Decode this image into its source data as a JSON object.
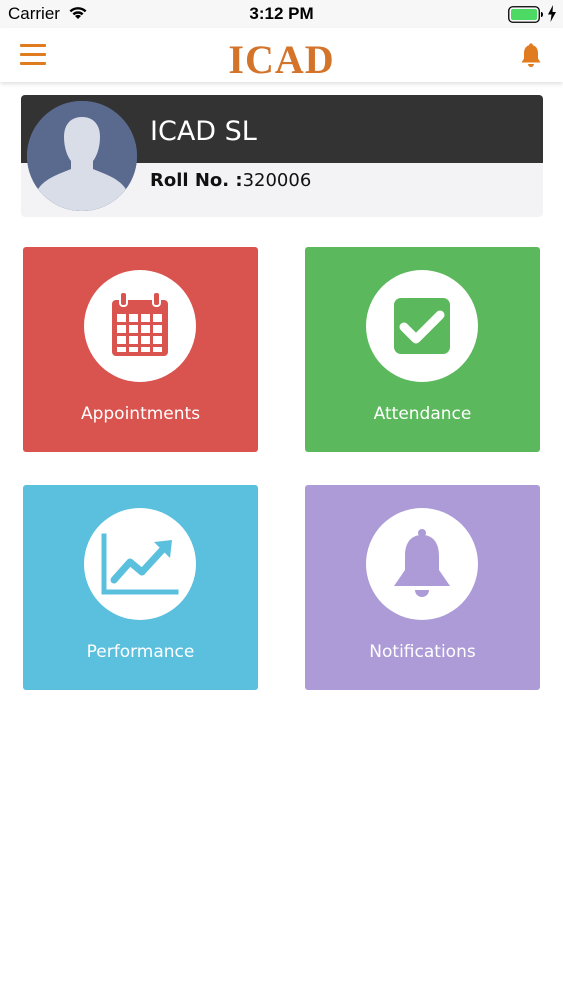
{
  "status_bar": {
    "carrier": "Carrier",
    "time": "3:12 PM",
    "battery_color": "#4cd964"
  },
  "navbar": {
    "title": "ICAD",
    "title_color": "#d4742a",
    "accent": "#e07b1f",
    "menu_icon": "hamburger-menu-icon",
    "bell_icon": "notification-bell-icon"
  },
  "profile": {
    "name": "ICAD SL",
    "roll_label": "Roll No. :",
    "roll_number": "320006"
  },
  "tiles": [
    {
      "label": "Appointments",
      "color": "#d9534f",
      "icon": "calendar-icon"
    },
    {
      "label": "Attendance",
      "color": "#5cb85c",
      "icon": "checkbox-icon"
    },
    {
      "label": "Performance",
      "color": "#5bc0de",
      "icon": "chart-trend-icon"
    },
    {
      "label": "Notifications",
      "color": "#ad9bd8",
      "icon": "bell-icon"
    }
  ]
}
